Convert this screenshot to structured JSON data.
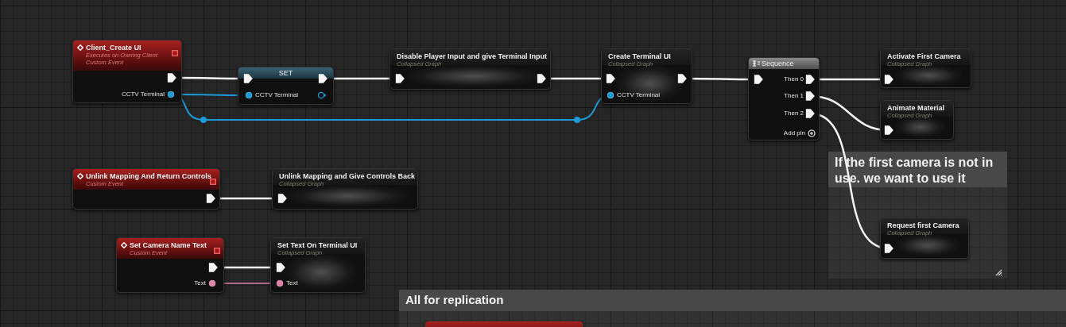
{
  "comments": [
    {
      "text": "If the first camera is not in use. we want to use it"
    },
    {
      "text": "All for replication"
    }
  ],
  "nodes": [
    {
      "kind": "event",
      "title": "Client_Create UI",
      "subtitles": [
        "Executes on Owning Client",
        "Custom Event"
      ],
      "replicated": true,
      "pins": [
        {
          "kind": "exec",
          "connected": true
        },
        {
          "kind": "object",
          "label": "CCTV Terminal",
          "connected": true
        }
      ]
    },
    {
      "kind": "set",
      "title": "SET",
      "pins": [
        {
          "kind": "exec",
          "connected": true
        },
        {
          "kind": "exec",
          "connected": true
        },
        {
          "kind": "object",
          "label": "CCTV Terminal",
          "connected": true
        },
        {
          "kind": "object",
          "connected": false
        }
      ]
    },
    {
      "kind": "collapsed",
      "title": "Disable Player Input and give Terminal Input",
      "subtitles": [
        "Collapsed Graph"
      ],
      "pins": [
        {
          "kind": "exec",
          "connected": true
        },
        {
          "kind": "exec",
          "connected": true
        }
      ]
    },
    {
      "kind": "collapsed",
      "title": "Create Terminal UI",
      "subtitles": [
        "Collapsed Graph"
      ],
      "pins": [
        {
          "kind": "exec",
          "connected": true
        },
        {
          "kind": "exec",
          "connected": true
        },
        {
          "kind": "object",
          "label": "CCTV Terminal",
          "connected": true
        }
      ]
    },
    {
      "kind": "sequence",
      "title": "Sequence",
      "add_pin": "Add pin",
      "pins": [
        {
          "kind": "exec",
          "connected": true
        },
        {
          "kind": "exec",
          "label": "Then 0",
          "connected": true
        },
        {
          "kind": "exec",
          "label": "Then 1",
          "connected": true
        },
        {
          "kind": "exec",
          "label": "Then 2",
          "connected": true
        }
      ]
    },
    {
      "kind": "collapsed",
      "title": "Activate First Camera",
      "subtitles": [
        "Collapsed Graph"
      ],
      "pins": [
        {
          "kind": "exec",
          "connected": true
        }
      ]
    },
    {
      "kind": "collapsed",
      "title": "Animate Material",
      "subtitles": [
        "Collapsed Graph"
      ],
      "pins": [
        {
          "kind": "exec",
          "connected": true
        }
      ]
    },
    {
      "kind": "collapsed",
      "title": "Request first Camera",
      "subtitles": [
        "Collapsed Graph"
      ],
      "pins": [
        {
          "kind": "exec",
          "connected": true
        }
      ]
    },
    {
      "kind": "event",
      "title": "Unlink Mapping And Return Controls",
      "subtitles": [
        "Custom Event"
      ],
      "replicated": true,
      "pins": [
        {
          "kind": "exec",
          "connected": true
        }
      ]
    },
    {
      "kind": "collapsed",
      "title": "Unlink Mapping and Give Controls Back",
      "subtitles": [
        "Collapsed Graph"
      ],
      "pins": [
        {
          "kind": "exec",
          "connected": true
        }
      ]
    },
    {
      "kind": "event",
      "title": "Set Camera Name Text",
      "subtitles": [
        "Custom Event"
      ],
      "replicated": true,
      "pins": [
        {
          "kind": "exec",
          "connected": true
        },
        {
          "kind": "text",
          "label": "Text",
          "connected": true
        }
      ]
    },
    {
      "kind": "collapsed",
      "title": "Set Text On Terminal UI",
      "subtitles": [
        "Collapsed Graph"
      ],
      "pins": [
        {
          "kind": "exec",
          "connected": true
        },
        {
          "kind": "text",
          "label": "Text",
          "connected": true
        }
      ]
    },
    {
      "kind": "event"
    }
  ],
  "wires": [
    {
      "kind": "exec"
    },
    {
      "kind": "object"
    },
    {
      "kind": "object",
      "via": [
        {
          "kind": "reroute"
        },
        {
          "kind": "reroute"
        }
      ]
    },
    {
      "kind": "exec"
    },
    {
      "kind": "exec"
    },
    {
      "kind": "exec"
    },
    {
      "kind": "exec"
    },
    {
      "kind": "exec"
    },
    {
      "kind": "exec"
    },
    {
      "kind": "exec"
    },
    {
      "kind": "exec"
    },
    {
      "kind": "text"
    }
  ]
}
